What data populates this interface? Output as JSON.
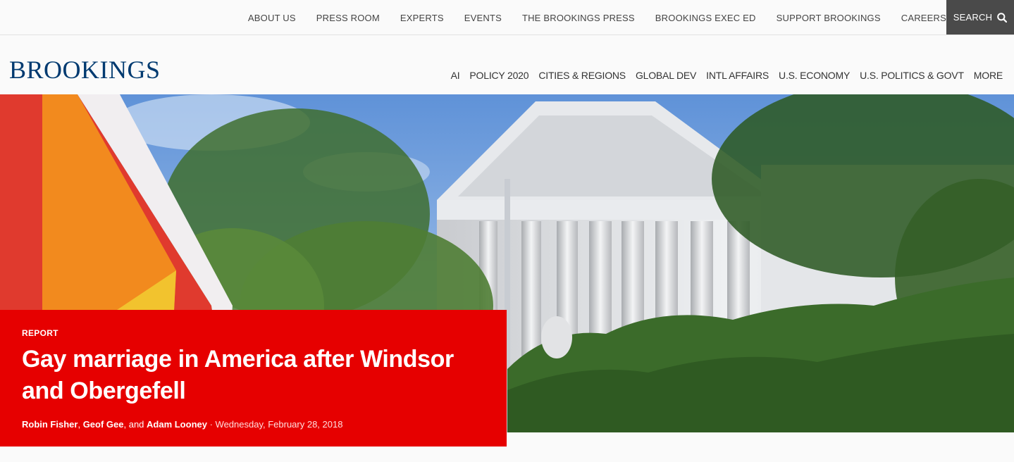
{
  "utility_nav": {
    "items": [
      "ABOUT US",
      "PRESS ROOM",
      "EXPERTS",
      "EVENTS",
      "THE BROOKINGS PRESS",
      "BROOKINGS EXEC ED",
      "SUPPORT BROOKINGS",
      "CAREERS"
    ],
    "search_label": "SEARCH"
  },
  "header": {
    "logo": "BROOKINGS",
    "nav": [
      "AI",
      "POLICY 2020",
      "CITIES & REGIONS",
      "GLOBAL DEV",
      "INTL AFFAIRS",
      "U.S. ECONOMY",
      "U.S. POLITICS & GOVT",
      "MORE"
    ]
  },
  "hero": {
    "type": "REPORT",
    "title": "Gay marriage in America after Windsor and Obergefell",
    "authors": [
      "Robin Fisher",
      "Geof Gee",
      "Adam Looney"
    ],
    "sep1": ", ",
    "sep2": ", and ",
    "dot": " · ",
    "date": "Wednesday, February 28, 2018"
  },
  "colors": {
    "brand": "#003a70",
    "hero_card": "#e60000",
    "search_bg": "#4a4a4a"
  },
  "icons": {
    "search": "search-icon"
  }
}
